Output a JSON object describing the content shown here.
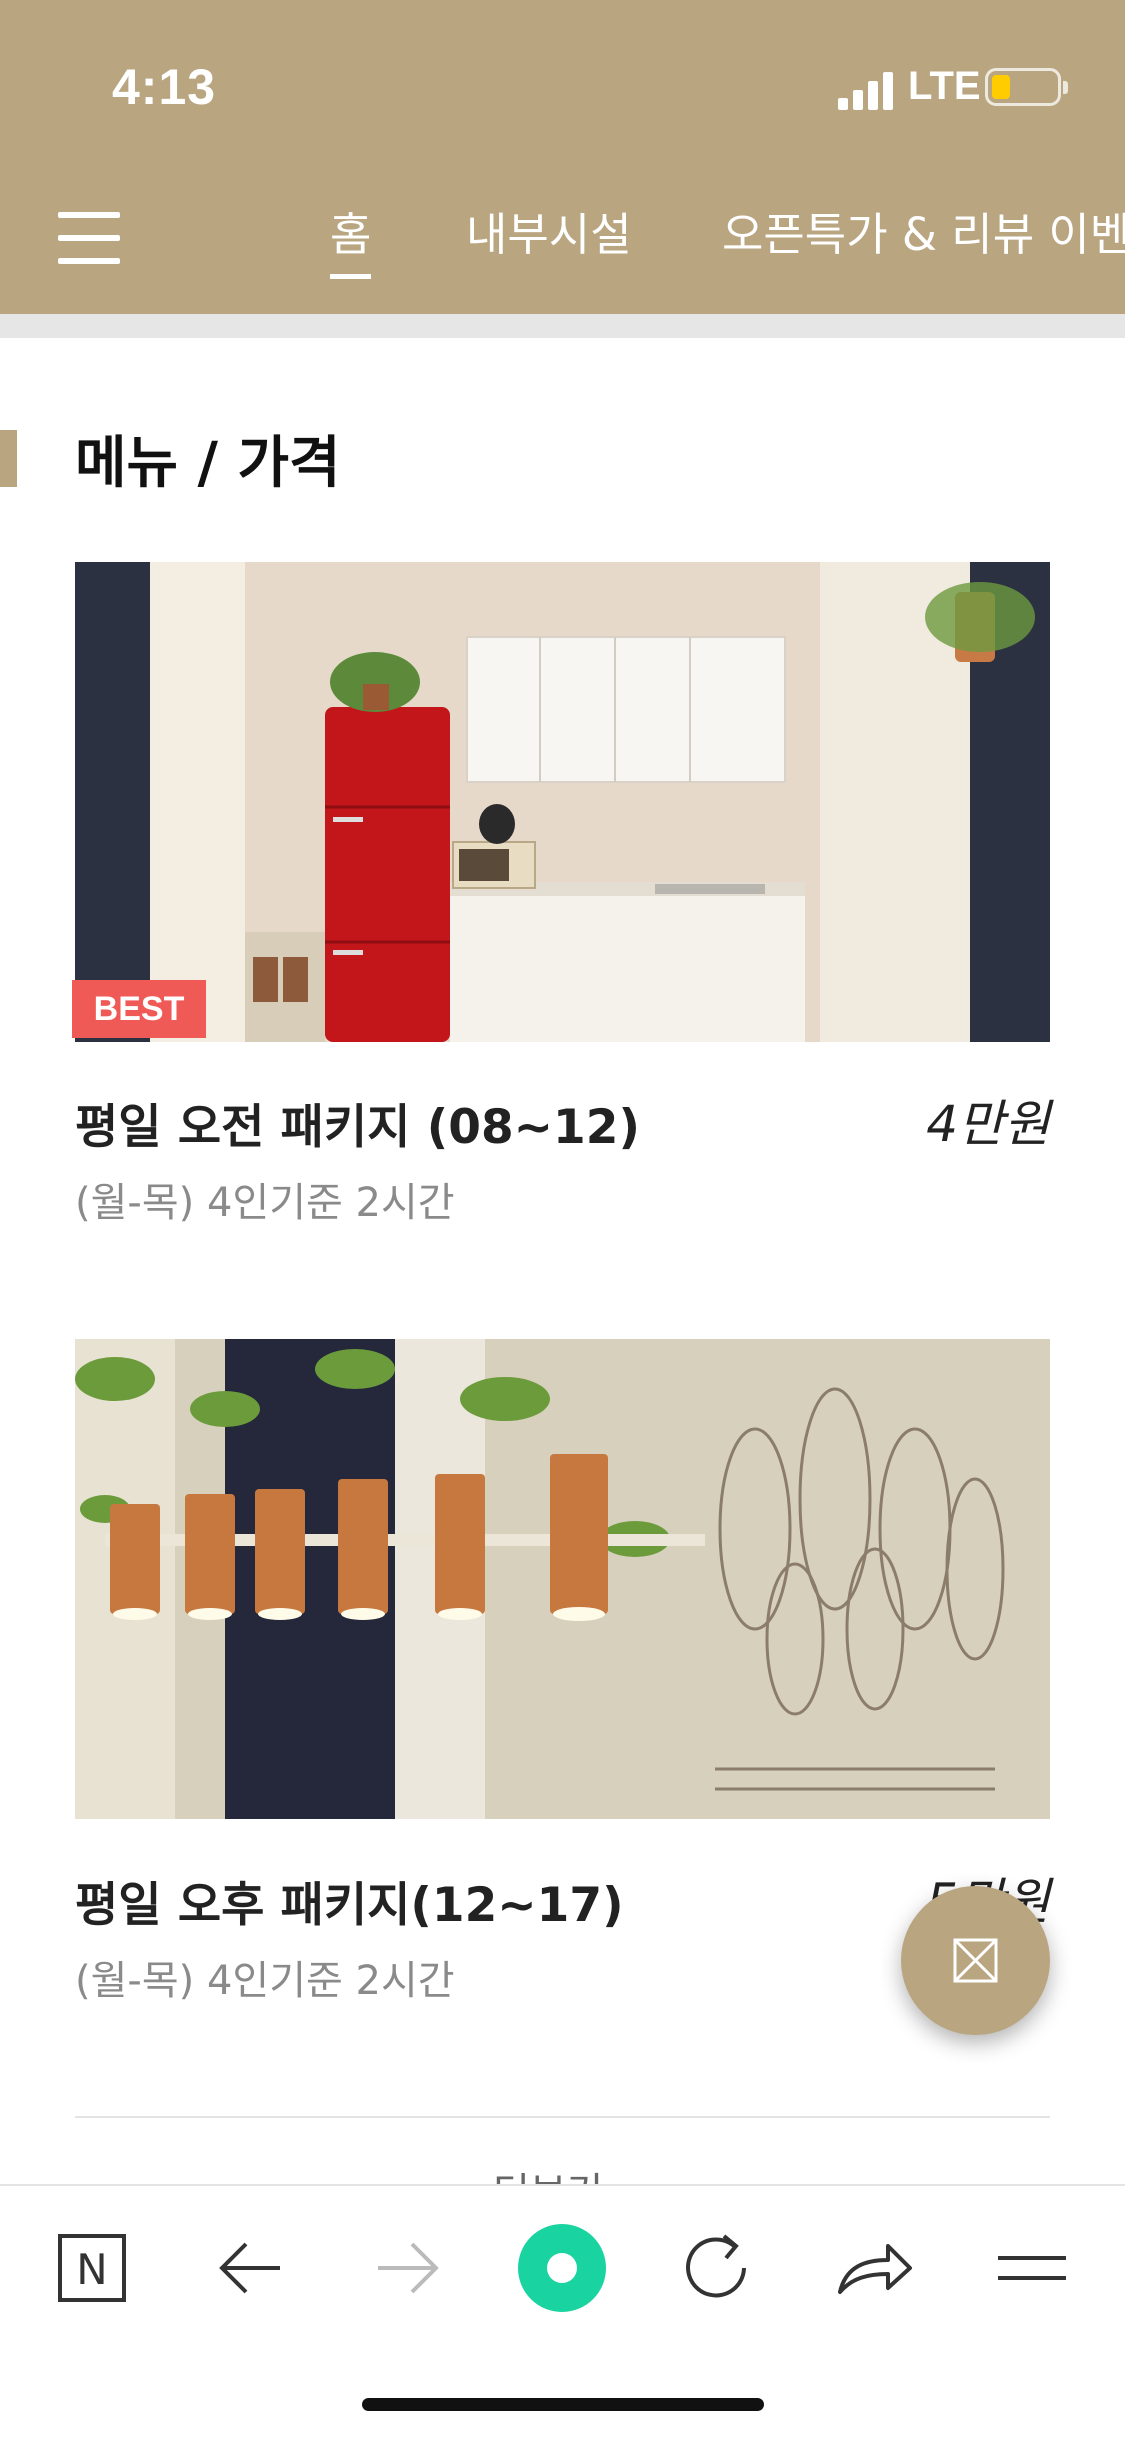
{
  "status_bar": {
    "time": "4:13",
    "network": "LTE"
  },
  "header": {
    "tabs": [
      {
        "label": "홈",
        "active": true
      },
      {
        "label": "내부시설",
        "active": false
      },
      {
        "label": "오픈특가 & 리뷰 이벤트",
        "active": false
      }
    ],
    "background_color": "#b9a681"
  },
  "section": {
    "title": "메뉴 / 가격"
  },
  "menu_items": [
    {
      "title": "평일 오전 패키지 (08~12)",
      "subtitle": "(월-목) 4인기준 2시간",
      "price": "4만원",
      "badge": "BEST",
      "image_icon": "kitchen-photo"
    },
    {
      "title": "평일 오후 패키지(12~17)",
      "subtitle": "(월-목) 4인기준 2시간",
      "price": "5만원",
      "image_icon": "pendant-light-photo"
    }
  ],
  "more_link": {
    "label": "더보기 ›"
  },
  "fab": {
    "icon": "close-box-icon"
  },
  "browser_toolbar": {
    "buttons": [
      "naver-icon",
      "back-arrow-icon",
      "forward-arrow-icon",
      "green-dot-icon",
      "refresh-icon",
      "share-icon",
      "menu-icon"
    ]
  },
  "colors": {
    "accent": "#b9a681",
    "badge": "#ef5a57",
    "green": "#19d4a0"
  }
}
